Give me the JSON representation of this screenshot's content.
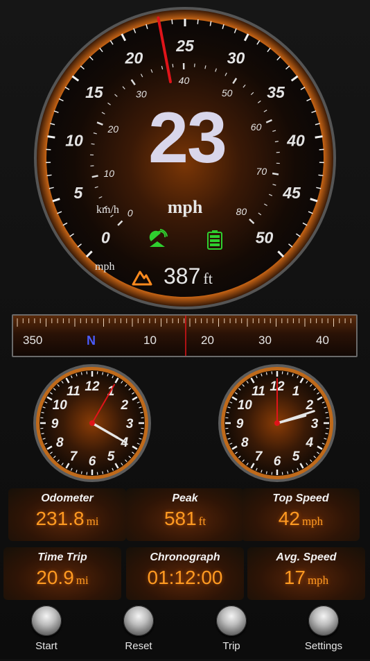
{
  "speedometer": {
    "speed": "23",
    "speed_unit": "mph",
    "inner_unit": "km/h",
    "outer_unit": "mph",
    "altitude_value": "387",
    "altitude_unit": "ft",
    "outer_scale": [
      "0",
      "5",
      "10",
      "15",
      "20",
      "25",
      "30",
      "35",
      "40",
      "45",
      "50"
    ],
    "inner_scale": [
      "0",
      "10",
      "20",
      "30",
      "40",
      "50",
      "60",
      "70",
      "80"
    ],
    "needle_value_mph": 23,
    "colors": {
      "accent": "#ff8a1e",
      "gps": "#2fcf2f",
      "battery": "#2fcf2f",
      "needle": "#e0141a"
    }
  },
  "compass": {
    "labels": [
      "350",
      "N",
      "10",
      "20",
      "30",
      "40"
    ],
    "heading_marker": "red-line"
  },
  "clocks": [
    {
      "numbers": [
        "12",
        "1",
        "2",
        "3",
        "4",
        "5",
        "6",
        "7",
        "8",
        "9",
        "10",
        "11"
      ],
      "hour": 4.0,
      "minute": 20,
      "second": 5
    },
    {
      "numbers": [
        "12",
        "1",
        "2",
        "3",
        "4",
        "5",
        "6",
        "7",
        "8",
        "9",
        "10",
        "11"
      ],
      "hour": 2.5,
      "minute": 12,
      "second": 0
    }
  ],
  "stats": [
    {
      "label": "Odometer",
      "value": "231.8",
      "unit": "mi"
    },
    {
      "label": "Peak",
      "value": "581",
      "unit": "ft"
    },
    {
      "label": "Top Speed",
      "value": "42",
      "unit": "mph"
    },
    {
      "label": "Time Trip",
      "value": "20.9",
      "unit": "mi"
    },
    {
      "label": "Chronograph",
      "value": "01:12:00",
      "unit": ""
    },
    {
      "label": "Avg. Speed",
      "value": "17",
      "unit": "mph"
    }
  ],
  "buttons": [
    {
      "label": "Start"
    },
    {
      "label": "Reset"
    },
    {
      "label": "Trip"
    },
    {
      "label": "Settings"
    }
  ]
}
